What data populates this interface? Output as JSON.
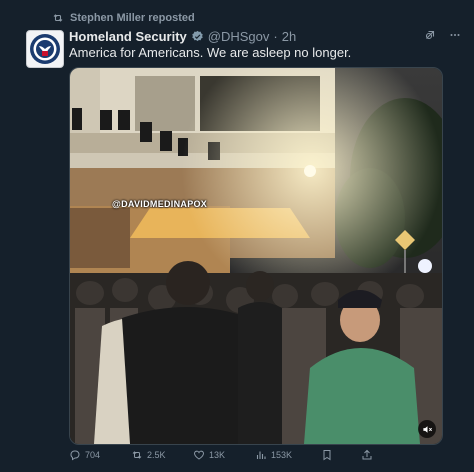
{
  "repost": {
    "text": "Stephen Miller reposted"
  },
  "tweet": {
    "author_name": "Homeland Security",
    "handle": "@DHSgov",
    "separator": "·",
    "time": "2h",
    "text": "America for Americans. We are asleep no longer.",
    "media_watermark": "@DAVIDMEDINAPOX"
  },
  "metrics": {
    "replies": "704",
    "reposts": "2.5K",
    "likes": "13K",
    "views": "153K"
  },
  "icons": {
    "repost": "repost-icon",
    "verified": "verified-badge-icon",
    "grok": "grok-icon",
    "more": "more-icon",
    "reply": "reply-icon",
    "like": "heart-icon",
    "views": "views-icon",
    "bookmark": "bookmark-icon",
    "share": "share-icon",
    "mute": "mute-icon"
  },
  "colors": {
    "background": "#15202b",
    "secondary_text": "#8b98a5",
    "verified_badge": "#829aab"
  }
}
